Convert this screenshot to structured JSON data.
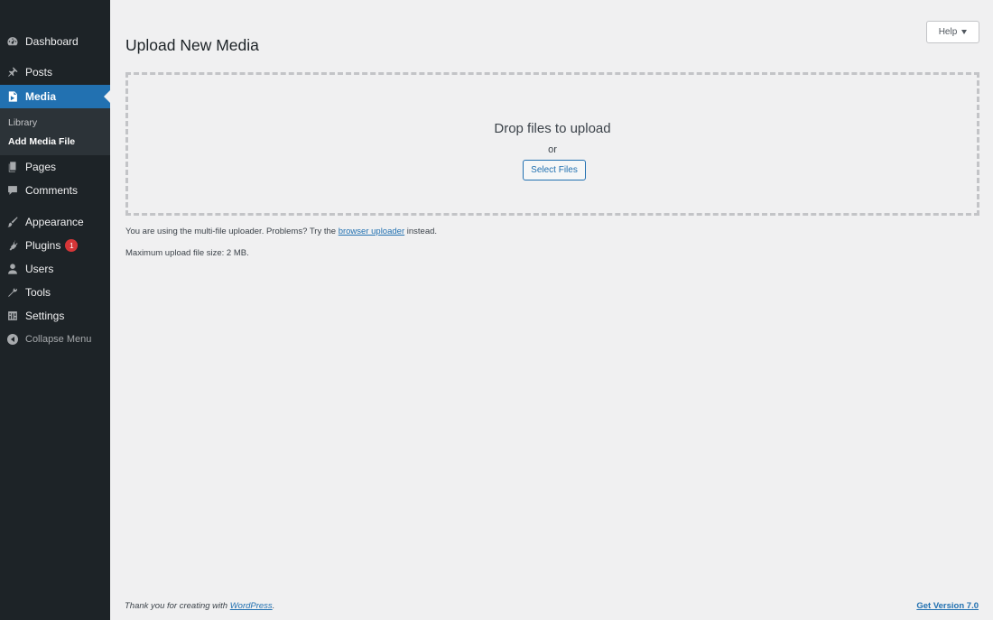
{
  "sidebar": {
    "dashboard": "Dashboard",
    "posts": "Posts",
    "media": "Media",
    "media_sub": {
      "library": "Library",
      "add_media_file": "Add Media File"
    },
    "pages": "Pages",
    "comments": "Comments",
    "appearance": "Appearance",
    "plugins": "Plugins",
    "plugins_badge": "1",
    "users": "Users",
    "tools": "Tools",
    "settings": "Settings",
    "collapse": "Collapse Menu"
  },
  "header": {
    "title": "Upload New Media",
    "help_label": "Help"
  },
  "uploader": {
    "drop_text": "Drop files to upload",
    "or_text": "or",
    "select_button": "Select Files"
  },
  "info": {
    "multi_prefix": "You are using the multi-file uploader. Problems? Try the",
    "browser_uploader_link": "browser uploader",
    "multi_suffix": "instead.",
    "max_size": "Maximum upload file size: 2 MB."
  },
  "footer": {
    "thanks_prefix": "Thank you for creating with",
    "wordpress_link": "WordPress",
    "thanks_suffix": ".",
    "version_link": "Get Version 7.0"
  },
  "colors": {
    "sidebar_bg": "#1d2327",
    "accent": "#2271b1",
    "badge": "#d63638",
    "page_bg": "#f0f0f1"
  }
}
